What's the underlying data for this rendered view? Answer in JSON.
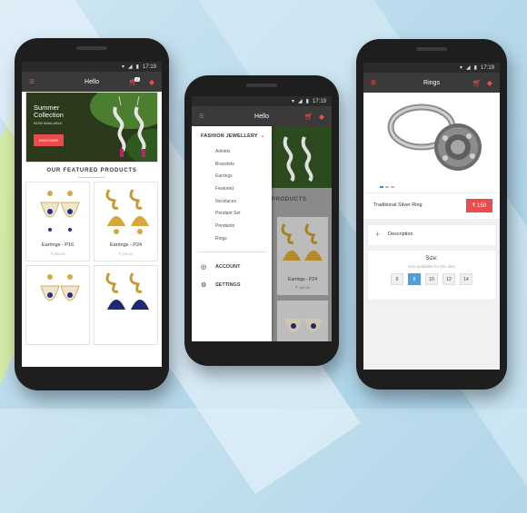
{
  "status": {
    "time": "17:19"
  },
  "colors": {
    "accent": "#e94c4c",
    "appbar": "#3a3a3a",
    "selected_size": "#4b9ee0"
  },
  "home": {
    "title": "Hello",
    "cart_count": "2",
    "banner": {
      "line1": "Summer",
      "line2": "Collection",
      "sub": "NOW AVAILABLE",
      "cta": "DISCOVER"
    },
    "featured_title": "OUR FEATURED PRODUCTS",
    "products": [
      {
        "name": "Earrings - P16",
        "price": "₹ 250.00",
        "icon": "chandbali-earring"
      },
      {
        "name": "Earrings - P24",
        "price": "₹ 150.00",
        "icon": "jhumka-earring"
      },
      {
        "name": "",
        "price": "",
        "icon": "chandbali-earring"
      },
      {
        "name": "",
        "price": "",
        "icon": "jhumka-earring"
      }
    ]
  },
  "drawer_screen": {
    "title": "Hello",
    "section": "FASHION JEWELLERY",
    "items": [
      "Anklets",
      "Bracelets",
      "Earrings",
      "Featured",
      "Necklaces",
      "Pendant Set",
      "Pendants",
      "Rings"
    ],
    "account": "ACCOUNT",
    "settings": "SETTINGS",
    "peek_heading": "PRODUCTS",
    "peek_product": {
      "name": "Earrings - P24",
      "price": "₹ 150.00"
    }
  },
  "ring_screen": {
    "title": "Rings",
    "product_name": "Traditional Silver Ring",
    "price": "₹ 150",
    "description_label": "Description",
    "size_title": "Size:",
    "size_sub": "Size available for this item",
    "sizes": [
      "6",
      "8",
      "10",
      "12",
      "14"
    ],
    "selected_size": "8"
  }
}
